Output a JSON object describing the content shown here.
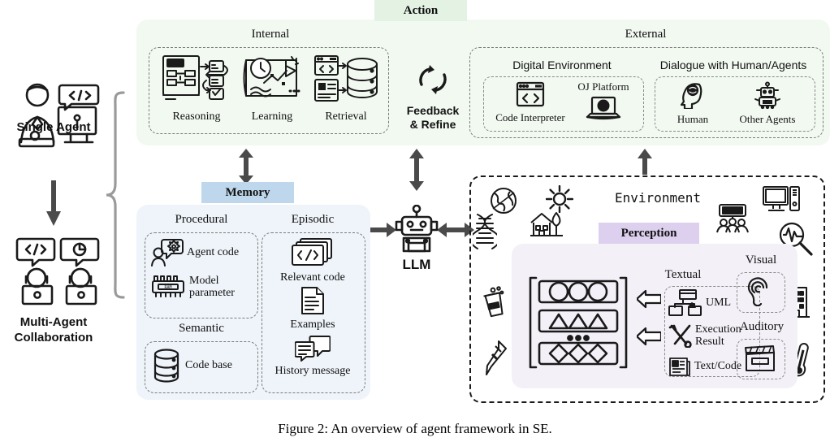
{
  "figure": {
    "caption": "Figure 2: An overview of agent framework in SE."
  },
  "colors": {
    "action_badge_bg": "#e3f2e2",
    "action_panel_bg": "#f2f9f1",
    "memory_badge_bg": "#bed7ec",
    "memory_panel_bg": "#eef4fa",
    "perception_badge_bg": "#ddd0ef",
    "perception_panel_bg": "#f3f0f7",
    "stroke": "#1a1a1a",
    "dashed": "#7b7b7b"
  },
  "left": {
    "single_agent": {
      "label": "Single Agent",
      "icon": "developer-at-computer-icon"
    },
    "flow_arrow": "down-arrow-icon",
    "multi_agent": {
      "label": "Multi-Agent\nCollaboration",
      "line1": "Multi-Agent",
      "line2": "Collaboration",
      "icon": "two-agents-with-code-bubbles-icon"
    },
    "brace": "right-curly-brace"
  },
  "action": {
    "badge": "Action",
    "internal": {
      "title": "Internal",
      "items": [
        {
          "label": "Reasoning",
          "icon": "plan-flowchart-icon"
        },
        {
          "label": "Learning",
          "icon": "clock-chart-flag-icon"
        },
        {
          "label": "Retrieval",
          "icon": "code-database-icon"
        }
      ]
    },
    "feedback": {
      "line1": "Feedback",
      "line2": "& Refine",
      "icon": "refresh-cycle-icon"
    },
    "external": {
      "title": "External",
      "digital_environment": {
        "title": "Digital Environment",
        "items": [
          {
            "label": "Code Interpreter",
            "icon": "code-window-icon"
          },
          {
            "label": "OJ Platform",
            "icon": "laptop-globe-icon"
          }
        ]
      },
      "dialogue": {
        "title": "Dialogue with Human/Agents",
        "items": [
          {
            "label": "Human",
            "icon": "human-head-brain-icon"
          },
          {
            "label": "Other Agents",
            "icon": "robot-agent-icon"
          }
        ]
      }
    }
  },
  "memory": {
    "badge": "Memory",
    "procedural": {
      "title": "Procedural",
      "items": [
        {
          "label": "Agent code",
          "icon": "person-gear-bubble-icon"
        },
        {
          "label": "Model\nparameter",
          "line1": "Model",
          "line2": "parameter",
          "icon": "ram-chip-icon"
        }
      ]
    },
    "semantic": {
      "title": "Semantic",
      "items": [
        {
          "label": "Code base",
          "icon": "database-icon"
        }
      ]
    },
    "episodic": {
      "title": "Episodic",
      "items": [
        {
          "label": "Relevant code",
          "icon": "stacked-code-cards-icon"
        },
        {
          "label": "Examples",
          "icon": "document-icon"
        },
        {
          "label": "History message",
          "icon": "chat-messages-icon"
        }
      ]
    }
  },
  "llm": {
    "label": "LLM",
    "icon": "robot-icon",
    "arrow_up": "up-down-arrow-icon",
    "arrow_left": "left-right-arrow-icon",
    "arrow_right": "left-right-arrow-icon"
  },
  "environment": {
    "title": "Environment",
    "ambient_icons": [
      {
        "name": "globe-icon"
      },
      {
        "name": "sun-icon"
      },
      {
        "name": "dna-icon"
      },
      {
        "name": "house-tree-icon"
      },
      {
        "name": "lab-jar-icon"
      },
      {
        "name": "pipette-icon"
      },
      {
        "name": "presentation-audience-icon"
      },
      {
        "name": "desktop-computer-icon"
      },
      {
        "name": "waveform-magnifier-icon"
      },
      {
        "name": "office-building-icon"
      },
      {
        "name": "thermometer-icon"
      }
    ],
    "perception": {
      "badge": "Perception",
      "matrix": {
        "icon": "matrix-brackets-icon",
        "ellipsis": "..."
      },
      "arrows": [
        "left-arrow-icon",
        "left-arrow-icon"
      ],
      "textual": {
        "title": "Textual",
        "items": [
          {
            "label": "UML",
            "icon": "uml-diagram-icon"
          },
          {
            "label": "Execution\nResult",
            "line1": "Execution",
            "line2": "Result",
            "icon": "tools-icon"
          },
          {
            "label": "Text/Code",
            "icon": "newspaper-icon"
          }
        ]
      },
      "visual": {
        "title": "Visual",
        "icon": "ear-icon"
      },
      "auditory": {
        "title": "Auditory",
        "icon": "clapperboard-icon"
      }
    }
  }
}
